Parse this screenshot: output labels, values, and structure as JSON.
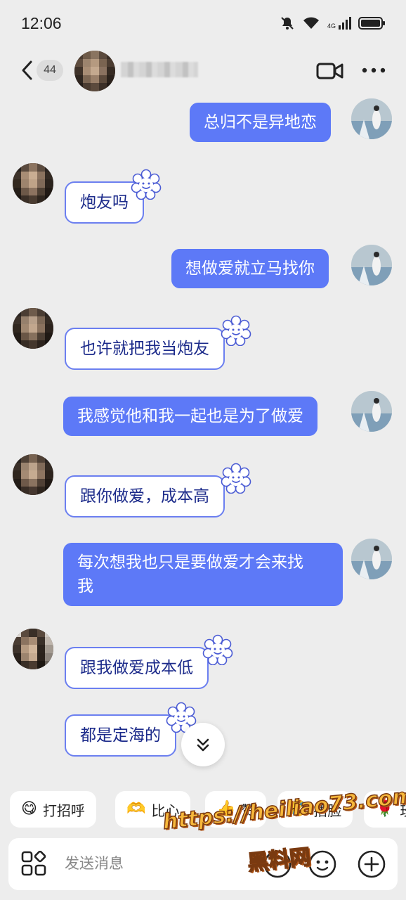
{
  "status_bar": {
    "time": "12:06",
    "network": "4G"
  },
  "header": {
    "unread_count": "44",
    "icons": [
      "back-icon",
      "video-call-icon",
      "more-icon"
    ]
  },
  "messages": [
    {
      "side": "right",
      "text": "总归不是异地恋"
    },
    {
      "side": "left",
      "text": "炮友吗"
    },
    {
      "side": "right",
      "text": "想做爱就立马找你"
    },
    {
      "side": "left",
      "text": "也许就把我当炮友"
    },
    {
      "side": "right",
      "text": "我感觉他和我一起也是为了做爱"
    },
    {
      "side": "left",
      "text": "跟你做爱，成本高"
    },
    {
      "side": "right",
      "text": "每次想我也只是要做爱才会来找\n我"
    },
    {
      "side": "left",
      "text": "跟我做爱成本低"
    },
    {
      "side": "left",
      "text": "都是定海的"
    }
  ],
  "quick_replies": [
    {
      "emoji": "😋",
      "label": "打招呼"
    },
    {
      "emoji": "🫶",
      "label": "比心"
    },
    {
      "emoji": "👍",
      "label": "赞"
    },
    {
      "emoji": "🤣",
      "label": "捂脸"
    },
    {
      "emoji": "🌹",
      "label": "玫"
    }
  ],
  "input": {
    "placeholder": "发送消息"
  },
  "watermark": {
    "url": "https://heiliao73.com",
    "text": "黑料网"
  },
  "colors": {
    "outgoing_bubble": "#5d79f7",
    "incoming_text": "#1b2a8a",
    "background": "#ededed"
  }
}
